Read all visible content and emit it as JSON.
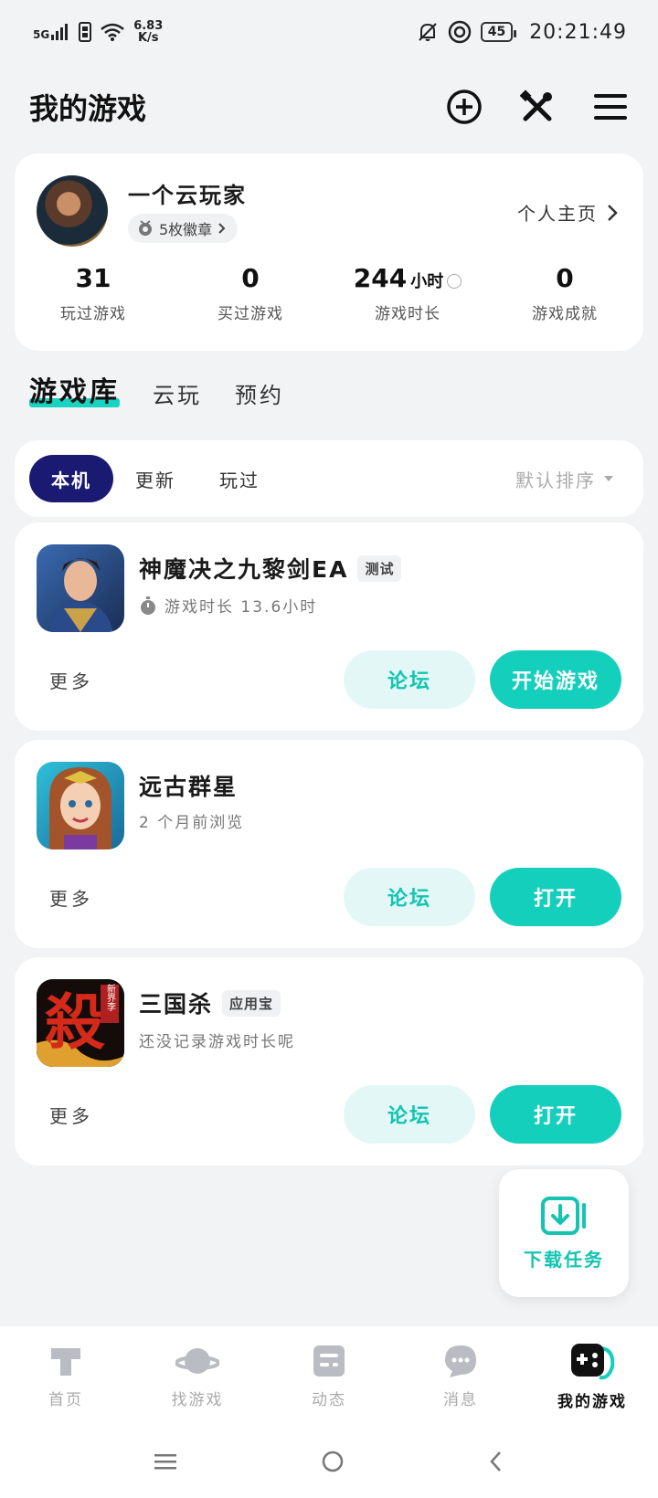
{
  "status_bar": {
    "network": "5G",
    "speed_value": "6.83",
    "speed_unit": "K/s",
    "battery": "45",
    "time": "20:21:49"
  },
  "header": {
    "title": "我的游戏",
    "icons": [
      "add-circle-icon",
      "tools-icon",
      "menu-icon"
    ]
  },
  "profile": {
    "username": "一个云玩家",
    "badges": "5枚徽章",
    "homepage_link": "个人主页",
    "stats": [
      {
        "value": "31",
        "unit": "",
        "label": "玩过游戏"
      },
      {
        "value": "0",
        "unit": "",
        "label": "买过游戏"
      },
      {
        "value": "244",
        "unit": "小时",
        "label": "游戏时长"
      },
      {
        "value": "0",
        "unit": "",
        "label": "游戏成就"
      }
    ]
  },
  "main_tabs": [
    "游戏库",
    "云玩",
    "预约"
  ],
  "filter": {
    "tabs": [
      "本机",
      "更新",
      "玩过"
    ],
    "sort_label": "默认排序"
  },
  "games": [
    {
      "name": "神魔决之九黎剑EA",
      "tag": "测试",
      "subtitle": "游戏时长 13.6小时",
      "more": "更多",
      "forum": "论坛",
      "action": "开始游戏"
    },
    {
      "name": "远古群星",
      "tag": "",
      "subtitle": "2 个月前浏览",
      "more": "更多",
      "forum": "论坛",
      "action": "打开"
    },
    {
      "name": "三国杀",
      "tag": "应用宝",
      "subtitle": "还没记录游戏时长呢",
      "more": "更多",
      "forum": "论坛",
      "action": "打开"
    }
  ],
  "game3_icon_text": {
    "main": "殺",
    "side": "新界李"
  },
  "fab": {
    "label": "下载任务"
  },
  "bottom_nav": [
    {
      "label": "首页",
      "icon": "home-icon"
    },
    {
      "label": "找游戏",
      "icon": "planet-icon"
    },
    {
      "label": "动态",
      "icon": "feed-icon"
    },
    {
      "label": "消息",
      "icon": "message-icon"
    },
    {
      "label": "我的游戏",
      "icon": "gamepad-icon"
    }
  ],
  "colors": {
    "accent": "#15cfbd",
    "active_filter": "#1a1a72"
  }
}
